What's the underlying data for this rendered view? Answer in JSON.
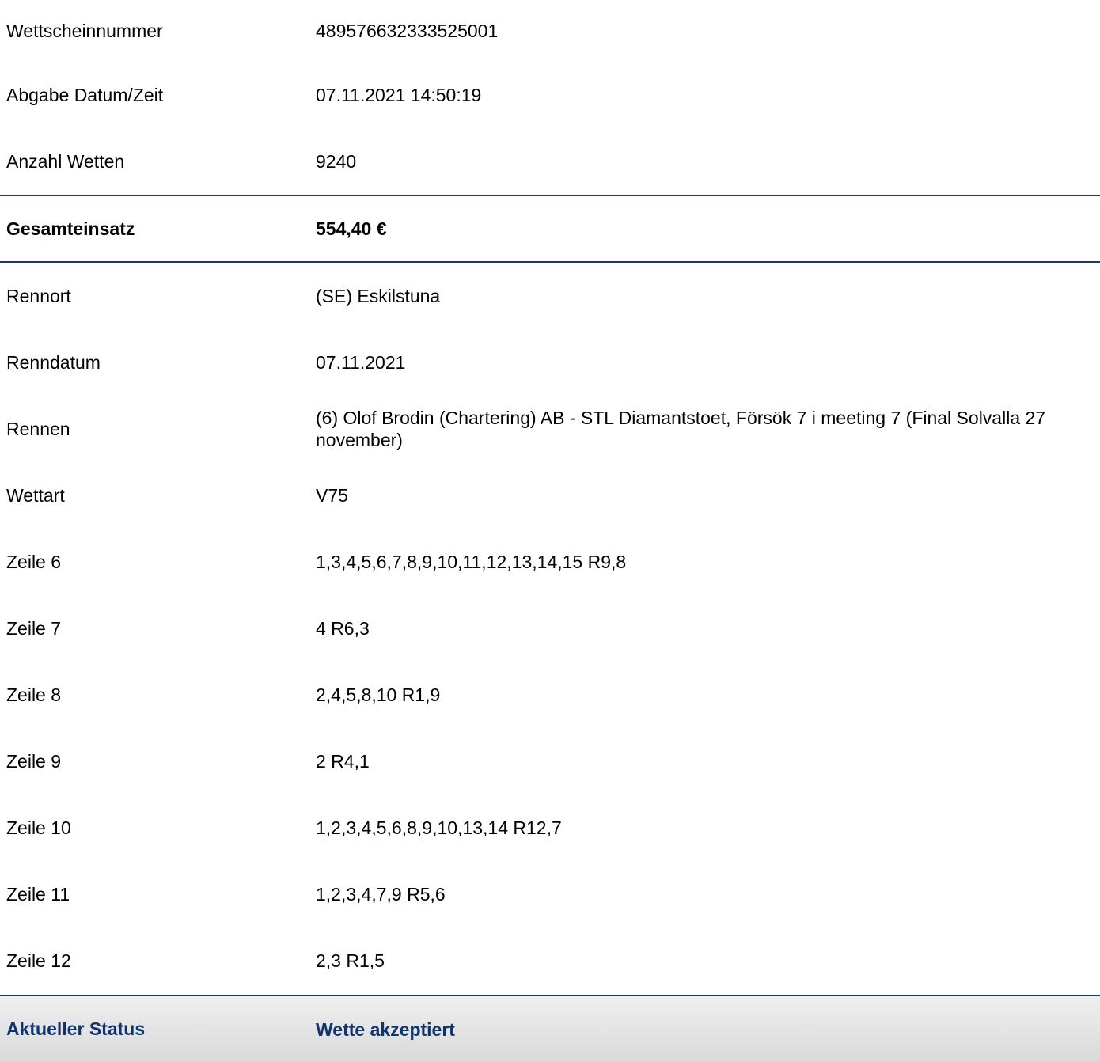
{
  "ticket": {
    "number_label": "Wettscheinnummer",
    "number_value": "489576632333525001",
    "submitted_label": "Abgabe Datum/Zeit",
    "submitted_value": "07.11.2021 14:50:19",
    "bet_count_label": "Anzahl Wetten",
    "bet_count_value": "9240"
  },
  "total": {
    "label": "Gesamteinsatz",
    "value": "554,40 €"
  },
  "race": {
    "venue_label": "Rennort",
    "venue_value": "(SE) Eskilstuna",
    "date_label": "Renndatum",
    "date_value": "07.11.2021",
    "race_label": "Rennen",
    "race_value": "(6) Olof Brodin (Chartering) AB - STL Diamantstoet, Försök 7 i meeting 7 (Final Solvalla 27 november)",
    "bet_type_label": "Wettart",
    "bet_type_value": "V75"
  },
  "lines": [
    {
      "label": "Zeile 6",
      "value": "1,3,4,5,6,7,8,9,10,11,12,13,14,15 R9,8"
    },
    {
      "label": "Zeile 7",
      "value": "4 R6,3"
    },
    {
      "label": "Zeile 8",
      "value": "2,4,5,8,10 R1,9"
    },
    {
      "label": "Zeile 9",
      "value": "2 R4,1"
    },
    {
      "label": "Zeile 10",
      "value": "1,2,3,4,5,6,8,9,10,13,14 R12,7"
    },
    {
      "label": "Zeile 11",
      "value": "1,2,3,4,7,9 R5,6"
    },
    {
      "label": "Zeile 12",
      "value": "2,3 R1,5"
    }
  ],
  "status": {
    "label": "Aktueller Status",
    "value": "Wette akzeptiert"
  },
  "colors": {
    "divider": "#1b3a5c",
    "status_text": "#0f3570",
    "status_background": "#e4e4e4"
  }
}
